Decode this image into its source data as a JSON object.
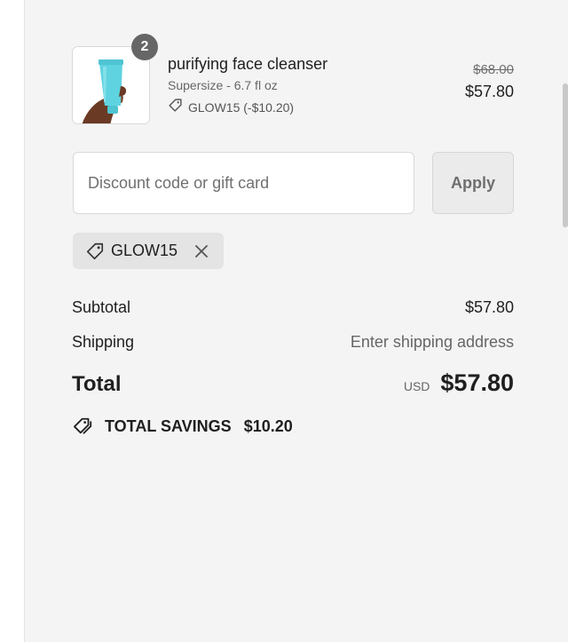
{
  "cart": {
    "item": {
      "name": "purifying face cleanser",
      "variant": "Supersize - 6.7 fl oz",
      "quantity": "2",
      "discount_line": "GLOW15 (-$10.20)",
      "original_price": "$68.00",
      "price": "$57.80"
    }
  },
  "discount_form": {
    "placeholder": "Discount code or gift card",
    "value": "",
    "apply_label": "Apply"
  },
  "applied_code": {
    "code": "GLOW15"
  },
  "summary": {
    "subtotal_label": "Subtotal",
    "subtotal_value": "$57.80",
    "shipping_label": "Shipping",
    "shipping_value": "Enter shipping address",
    "total_label": "Total",
    "currency": "USD",
    "total_value": "$57.80",
    "savings_label": "TOTAL SAVINGS",
    "savings_value": "$10.20"
  },
  "colors": {
    "panel_background": "#f4f4f4",
    "badge": "#666666",
    "product_tube": "#5fd3e0"
  },
  "icons": [
    "tag-icon",
    "close-icon",
    "savings-tags-icon"
  ]
}
